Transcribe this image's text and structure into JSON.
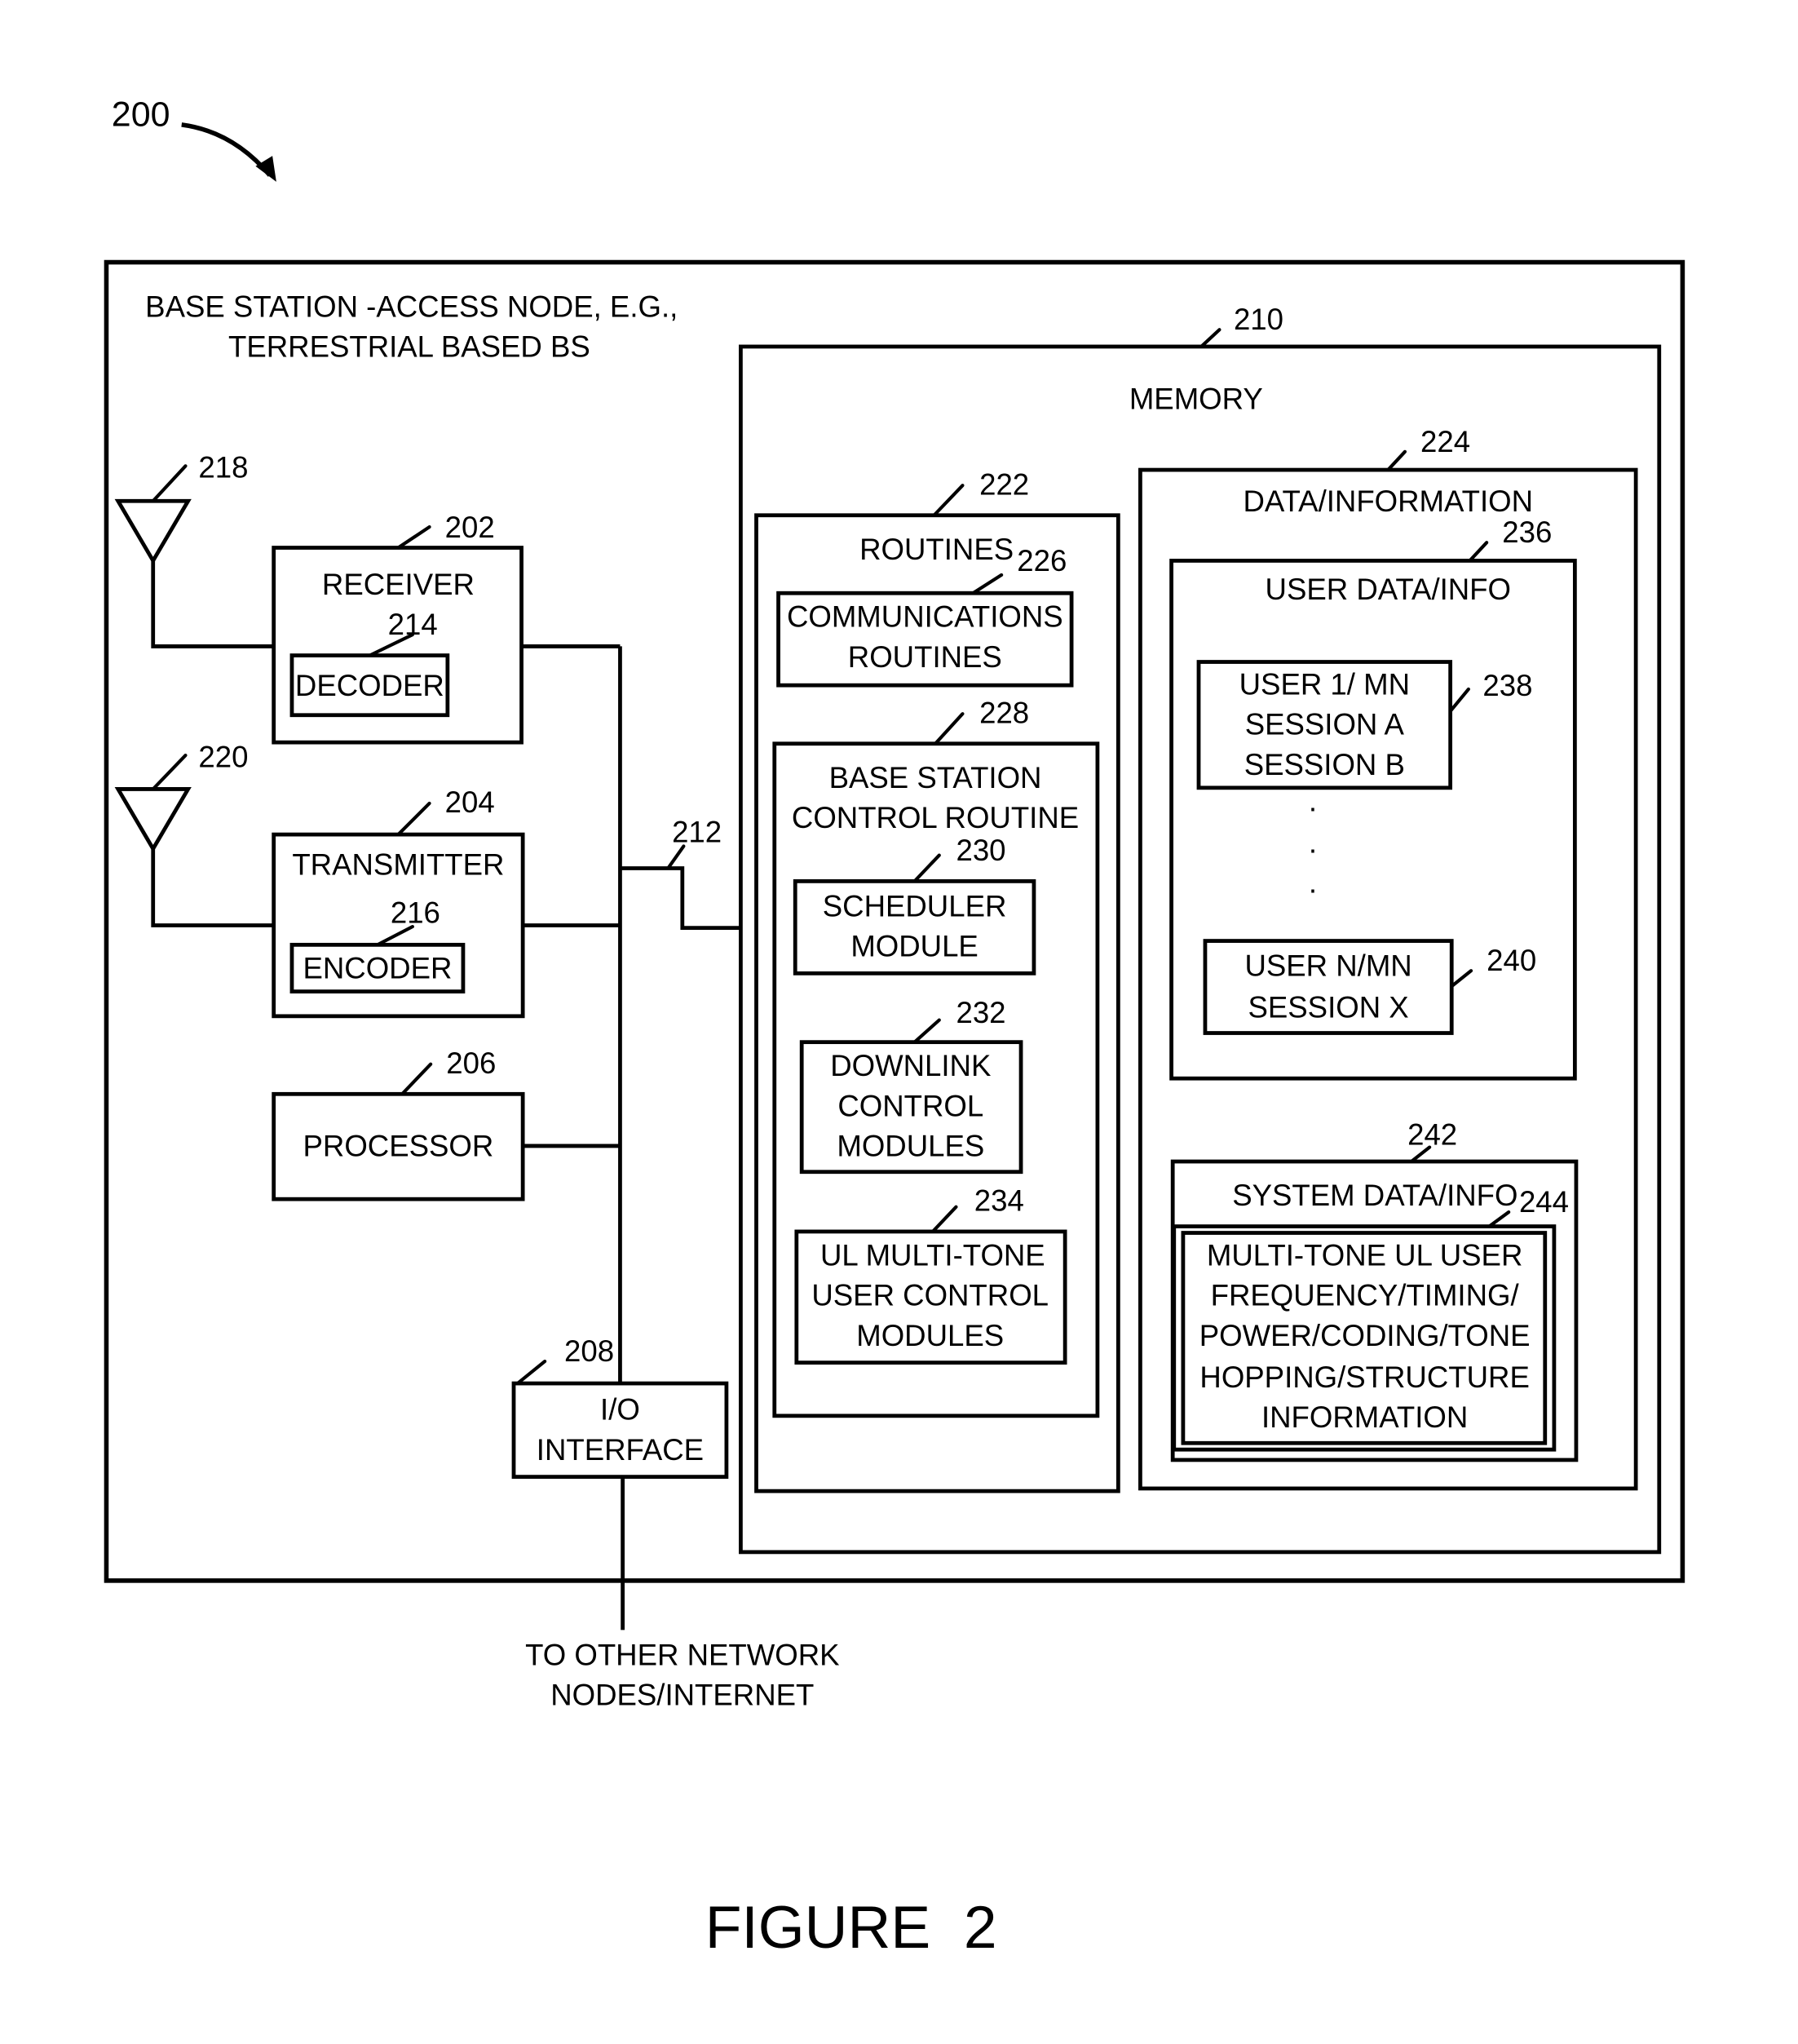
{
  "figure": {
    "ref": "200",
    "caption": "FIGURE  2"
  },
  "base_station": {
    "title_line1": "BASE STATION -ACCESS NODE, E.G.,",
    "title_line2": "TERRESTRIAL BASED BS"
  },
  "antennas": [
    {
      "ref": "218"
    },
    {
      "ref": "220"
    }
  ],
  "receiver": {
    "ref": "202",
    "label": "RECEIVER",
    "decoder": {
      "ref": "214",
      "label": "DECODER"
    }
  },
  "transmitter": {
    "ref": "204",
    "label": "TRANSMITTER",
    "encoder": {
      "ref": "216",
      "label": "ENCODER"
    }
  },
  "processor": {
    "ref": "206",
    "label": "PROCESSOR"
  },
  "io_interface": {
    "ref": "208",
    "line1": "I/O",
    "line2": "INTERFACE"
  },
  "bus": {
    "ref": "212"
  },
  "external": {
    "line1": "TO OTHER NETWORK",
    "line2": "NODES/INTERNET"
  },
  "memory": {
    "ref": "210",
    "label": "MEMORY",
    "routines": {
      "ref": "222",
      "label": "ROUTINES",
      "communications": {
        "ref": "226",
        "line1": "COMMUNICATIONS",
        "line2": "ROUTINES"
      },
      "control_routine": {
        "ref": "228",
        "line1": "BASE STATION",
        "line2": "CONTROL ROUTINE",
        "scheduler": {
          "ref": "230",
          "line1": "SCHEDULER",
          "line2": "MODULE"
        },
        "downlink": {
          "ref": "232",
          "line1": "DOWNLINK",
          "line2": "CONTROL",
          "line3": "MODULES"
        },
        "ul_multitone": {
          "ref": "234",
          "line1": "UL MULTI-TONE",
          "line2": "USER CONTROL",
          "line3": "MODULES"
        }
      }
    },
    "data_info": {
      "ref": "224",
      "label": "DATA/INFORMATION",
      "user_data": {
        "ref": "236",
        "label": "USER DATA/INFO",
        "user1": {
          "ref": "238",
          "line1": "USER 1/ MN",
          "line2": "SESSION A",
          "line3": "SESSION B"
        },
        "ellipsis": "·",
        "userN": {
          "ref": "240",
          "line1": "USER N/MN",
          "line2": "SESSION X"
        }
      },
      "system_data": {
        "ref": "242",
        "label": "SYSTEM DATA/INFO",
        "multitone": {
          "ref": "244",
          "line1": "MULTI-TONE UL USER",
          "line2": "FREQUENCY/TIMING/",
          "line3": "POWER/CODING/TONE",
          "line4": "HOPPING/STRUCTURE",
          "line5": "INFORMATION"
        }
      }
    }
  }
}
